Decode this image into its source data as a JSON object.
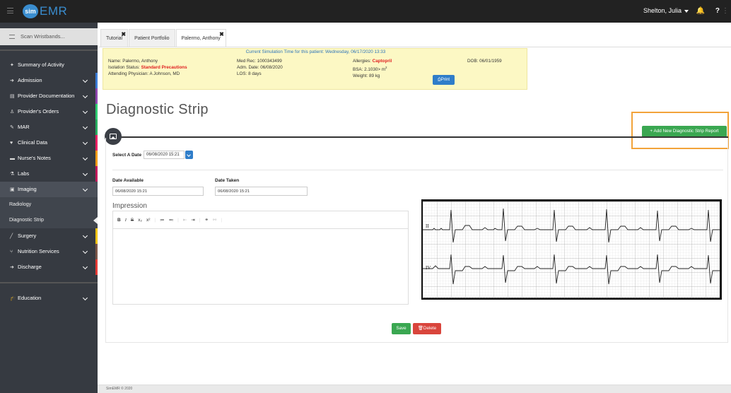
{
  "app": {
    "logo_sim": "sim",
    "logo_emr": "EMR"
  },
  "topbar": {
    "user": "Shelton, Julia"
  },
  "sidebar": {
    "scan": "Scan Wristbands...",
    "items": [
      {
        "label": "Summary of Activity",
        "icon": "dashboard-icon",
        "chevron": false,
        "color": ""
      },
      {
        "label": "Admission",
        "icon": "sign-in-icon",
        "chevron": true,
        "color": "#3a7bd5"
      },
      {
        "label": "Provider Documentation",
        "icon": "document-icon",
        "chevron": true,
        "color": "#8e44ad"
      },
      {
        "label": "Provider's Orders",
        "icon": "user-md-icon",
        "chevron": true,
        "color": "#2ecc71"
      },
      {
        "label": "MAR",
        "icon": "syringe-icon",
        "chevron": true,
        "color": "#27ae60"
      },
      {
        "label": "Clinical Data",
        "icon": "heartbeat-icon",
        "chevron": true,
        "color": "#e91e63"
      },
      {
        "label": "Nurse's Notes",
        "icon": "notes-icon",
        "chevron": true,
        "color": "#f39c12"
      },
      {
        "label": "Labs",
        "icon": "flask-icon",
        "chevron": true,
        "color": "#c2185b"
      },
      {
        "label": "Imaging",
        "icon": "image-icon",
        "chevron": true,
        "color": "",
        "active": true
      }
    ],
    "sub_items": [
      "Radiology",
      "Diagnostic Strip"
    ],
    "items2": [
      {
        "label": "Surgery",
        "icon": "scalpel-icon",
        "chevron": true,
        "color": "#f1c40f"
      },
      {
        "label": "Nutrition Services",
        "icon": "utensils-icon",
        "chevron": true,
        "color": "#795548"
      },
      {
        "label": "Discharge",
        "icon": "sign-out-icon",
        "chevron": true,
        "color": "#e53935"
      }
    ],
    "education": {
      "label": "Education",
      "icon": "graduation-cap-icon"
    }
  },
  "tabs": [
    "Tutorial",
    "Patient Portfolio",
    "Palermo, Anthony"
  ],
  "patient": {
    "sim_time": "Current Simulation Time for this patient: Wednesday, 06/17/2020 13:33",
    "name": "Name: Palermo, Anthony",
    "isolation_label": "Isolation Status: ",
    "isolation_value": "Standard Precautions",
    "physician": "Attending Physician: A Johnson, MD",
    "med_rec": "Med Rec: 1000343499",
    "adm_date": "Adm. Date: 06/08/2020",
    "los": "LOS: 8 days",
    "allergies_label": "Allergies: ",
    "allergies_value": "Captopril",
    "bsa": "BSA: 2.1030",
    "bsa_unit": "> m",
    "bsa_sup": "2",
    "weight": "Weight: 89 kg",
    "dob": "DOB: 06/01/1959",
    "print": "Print"
  },
  "page": {
    "title": "Diagnostic Strip",
    "add_button": "+ Add New Diagnostic Strip Report",
    "select_date_label": "Select A Date",
    "select_date_value": "06/08/2020 15:21",
    "date_available_label": "Date Available",
    "date_available_value": "06/08/2020 15:21",
    "date_taken_label": "Date Taken",
    "date_taken_value": "06/08/2020 15:21",
    "impression_label": "Impression",
    "toolbar": [
      "B",
      "I",
      "S",
      "x₂",
      "x²",
      "≔",
      "≕",
      "⇤",
      "⇥",
      "⚭",
      "⚯"
    ],
    "ekg_leads": [
      "II",
      "IV"
    ],
    "save": "Save",
    "delete": "Delete"
  },
  "footer": "SimEMR © 2020"
}
